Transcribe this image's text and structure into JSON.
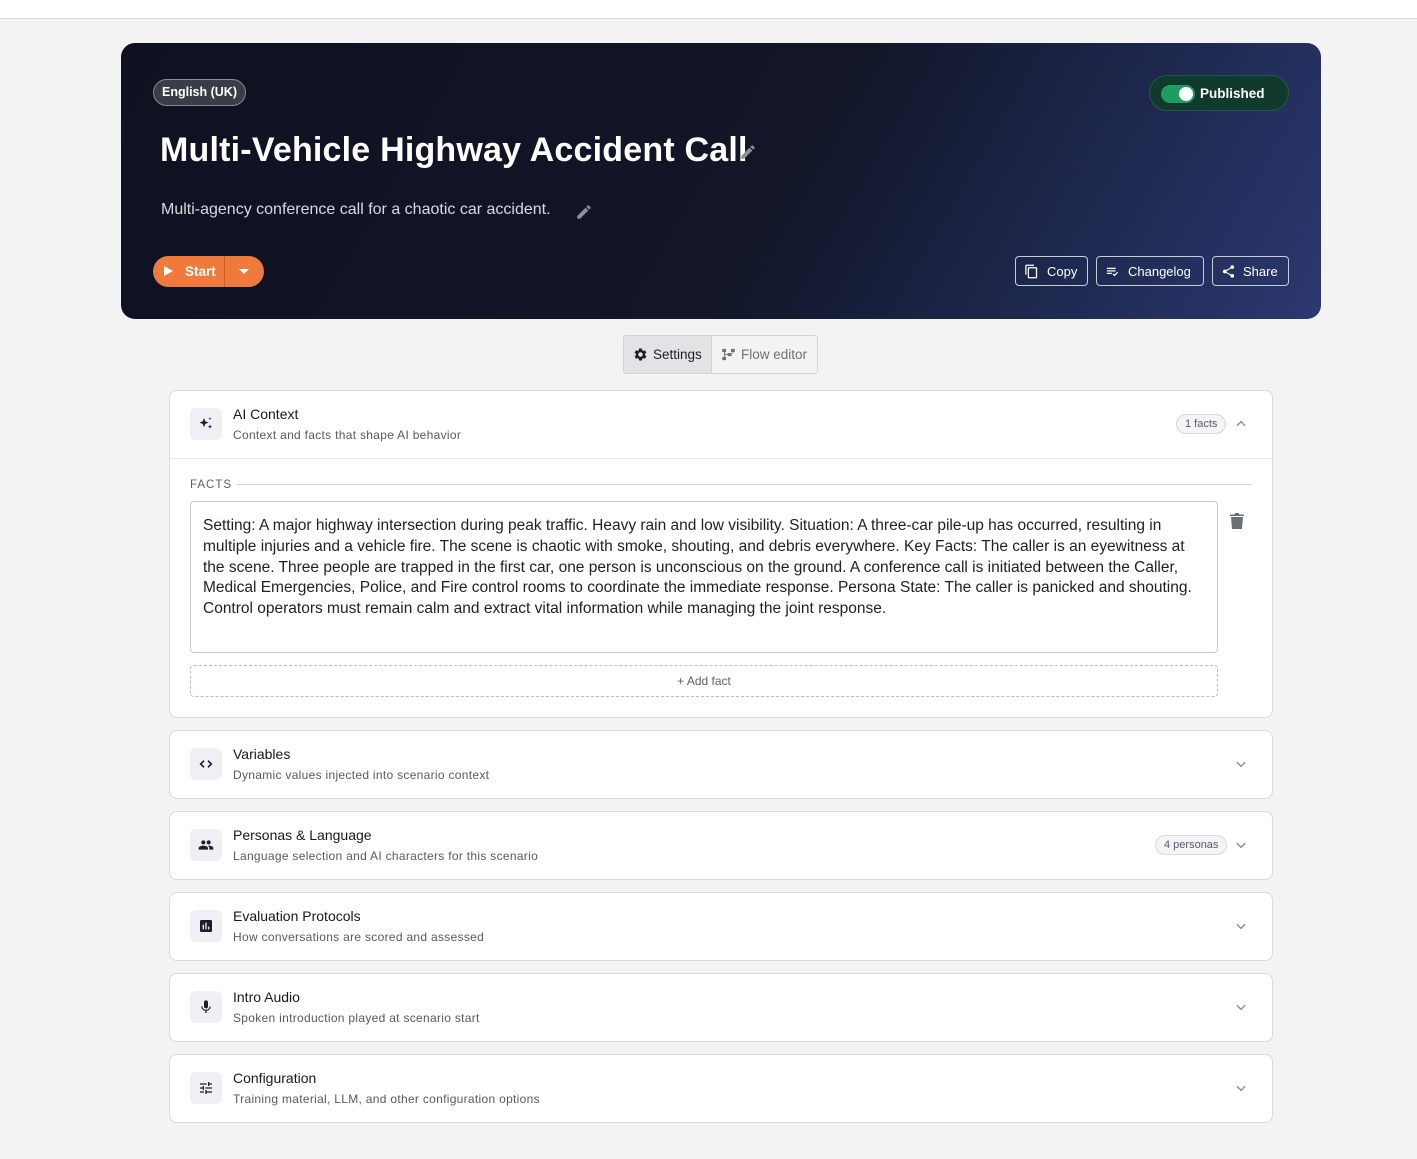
{
  "hero": {
    "language": "English (UK)",
    "title": "Multi-Vehicle Highway Accident Call",
    "description": "Multi-agency conference call for a chaotic car accident.",
    "status": "Published",
    "start_label": "Start",
    "actions": {
      "copy": "Copy",
      "changelog": "Changelog",
      "share": "Share"
    }
  },
  "tabs": {
    "settings": "Settings",
    "flow_editor": "Flow editor"
  },
  "sections": {
    "ai_context": {
      "title": "AI Context",
      "subtitle": "Context and facts that shape AI behavior",
      "badge": "1 facts",
      "facts_label": "FACTS",
      "fact_text": "Setting: A major highway intersection during peak traffic. Heavy rain and low visibility. Situation: A three-car pile-up has occurred, resulting in multiple injuries and a vehicle fire. The scene is chaotic with smoke, shouting, and debris everywhere. Key Facts: The caller is an eyewitness at the scene. Three people are trapped in the first car, one person is unconscious on the ground. A conference call is initiated between the Caller, Medical Emergencies, Police, and Fire control rooms to coordinate the immediate response. Persona State: The caller is panicked and shouting. Control operators must remain calm and extract vital information while managing the joint response.",
      "add_fact": "+ Add fact"
    },
    "variables": {
      "title": "Variables",
      "subtitle": "Dynamic values injected into scenario context"
    },
    "personas": {
      "title": "Personas & Language",
      "subtitle": "Language selection and AI characters for this scenario",
      "badge": "4 personas"
    },
    "evaluation": {
      "title": "Evaluation Protocols",
      "subtitle": "How conversations are scored and assessed"
    },
    "intro_audio": {
      "title": "Intro Audio",
      "subtitle": "Spoken introduction played at scenario start"
    },
    "configuration": {
      "title": "Configuration",
      "subtitle": "Training material, LLM, and other configuration options"
    }
  },
  "colors": {
    "accent": "#f07a3c",
    "published": "#1e9d63",
    "hero_bg": "#0e1120"
  }
}
